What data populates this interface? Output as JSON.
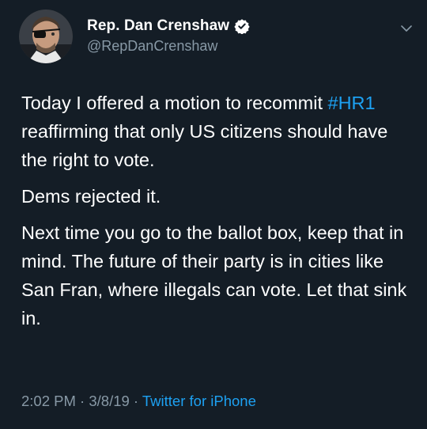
{
  "author": {
    "display_name": "Rep. Dan Crenshaw",
    "handle": "@RepDanCrenshaw",
    "verified": true,
    "verified_icon": "verified-badge-icon",
    "avatar": "profile-photo"
  },
  "tweet": {
    "line1_prefix": "Today I offered a motion to recommit",
    "hashtag": "#HR1",
    "line1_suffix": " reaffirming that only US citizens should have the right to vote.",
    "paragraph2": "Dems rejected it.",
    "paragraph3": "Next time you go to the ballot box, keep that in mind. The future of their party is in cities like San Fran, where illegals can vote. Let that sink in."
  },
  "meta": {
    "time": "2:02 PM",
    "sep1": " · ",
    "date": "3/8/19",
    "sep2": " · ",
    "source": "Twitter for iPhone"
  },
  "icons": {
    "menu": "chevron-down-icon"
  },
  "colors": {
    "background": "#141d26",
    "text": "#ffffff",
    "secondary": "#8899a6",
    "accent": "#1da1f2"
  }
}
